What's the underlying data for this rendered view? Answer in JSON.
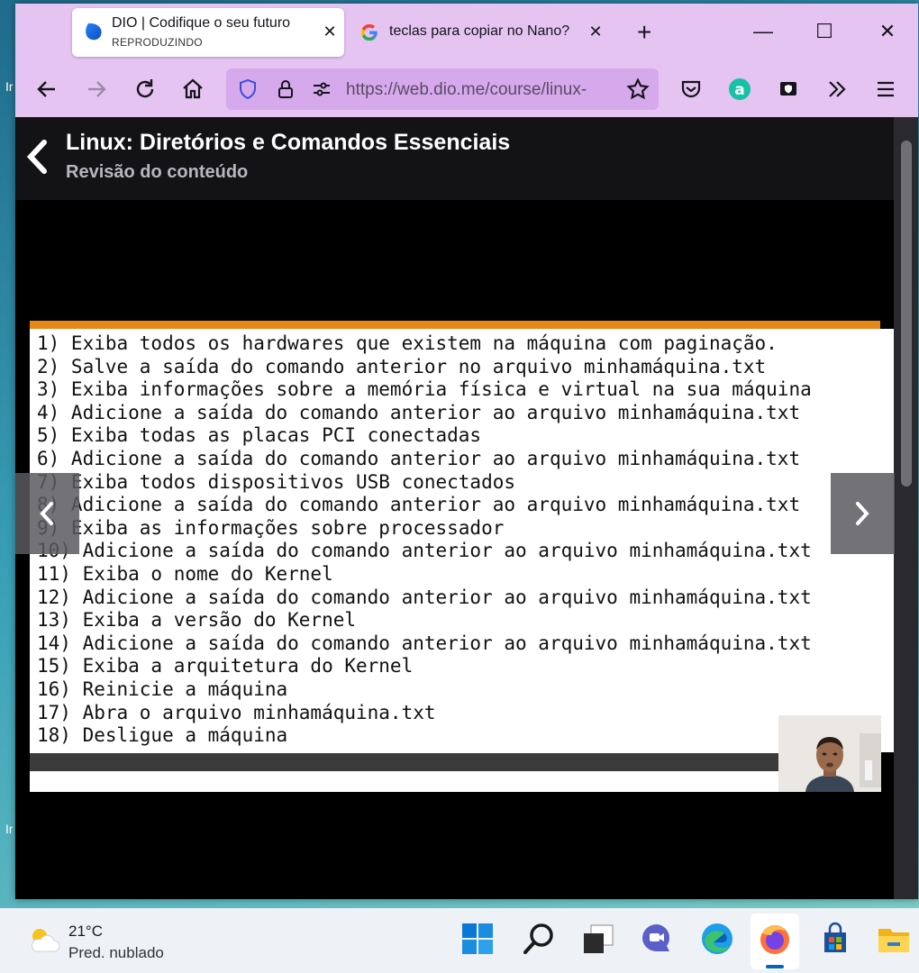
{
  "desktop": {
    "edge_text_top": "Ir",
    "edge_text_bottom": "Ir"
  },
  "browser": {
    "tabs": [
      {
        "title": "DIO | Codifique o seu futuro",
        "subtitle": "REPRODUZINDO",
        "icon": "dio-logo-icon",
        "active": true
      },
      {
        "title": "teclas para copiar no Nano?",
        "icon": "google-icon",
        "active": false
      }
    ],
    "new_tab": "+",
    "url": "https://web.dio.me/course/linux-",
    "accent": "#e6c4f2"
  },
  "course": {
    "title": "Linux: Diretórios e Comandos Essenciais",
    "subtitle": "Revisão do conteúdo"
  },
  "slide": {
    "lines": [
      "1) Exiba todos os hardwares que existem na máquina com paginação.",
      "2) Salve a saída do comando anterior no arquivo minhamáquina.txt",
      "3) Exiba informações sobre a memória física e virtual na sua máquina",
      "4) Adicione a saída do comando anterior ao arquivo minhamáquina.txt",
      "5) Exiba todas as placas PCI conectadas",
      "6) Adicione a saída do comando anterior ao arquivo minhamáquina.txt",
      "7) Exiba todos dispositivos USB conectados",
      "8) Adicione a saída do comando anterior ao arquivo minhamáquina.txt",
      "9) Exiba as informações sobre processador",
      "10) Adicione a saída do comando anterior ao arquivo minhamáquina.txt",
      "11) Exiba o nome do Kernel",
      "12) Adicione a saída do comando anterior ao arquivo minhamáquina.txt",
      "13) Exiba a versão do Kernel",
      "14) Adicione a saída do comando anterior ao arquivo minhamáquina.txt",
      "15) Exiba a arquitetura do Kernel",
      "16) Reinicie a máquina",
      "17) Abra o arquivo minhamáquina.txt",
      "18) Desligue a máquina"
    ],
    "accent": "#e8861a"
  },
  "taskbar": {
    "temperature": "21°C",
    "weather": "Pred. nublado",
    "apps": [
      "windows-start-icon",
      "search-icon",
      "task-view-icon",
      "chat-icon",
      "edge-icon",
      "firefox-icon",
      "store-icon",
      "file-explorer-icon"
    ]
  }
}
